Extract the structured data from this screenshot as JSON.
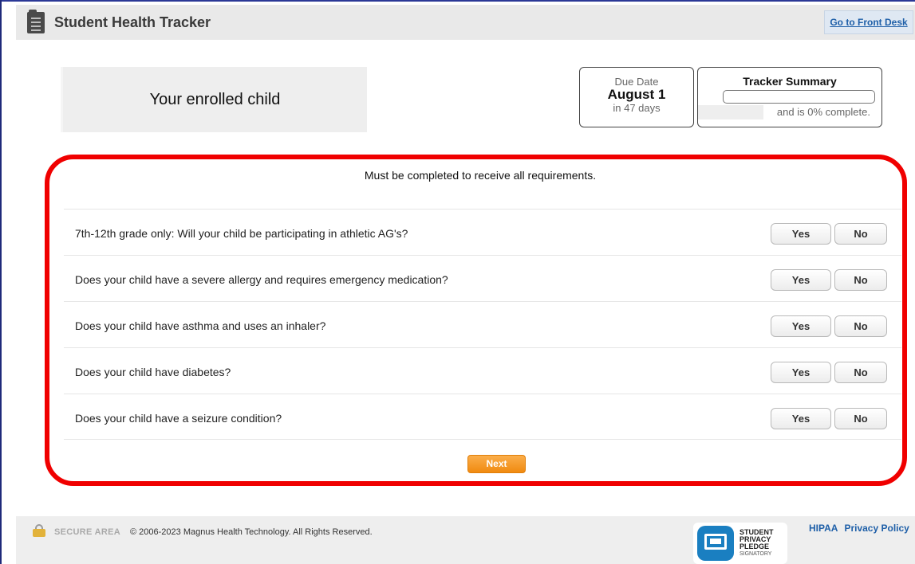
{
  "header": {
    "title": "Student Health Tracker",
    "front_desk_link": "Go to Front Desk"
  },
  "child_panel": {
    "label": "Your enrolled child"
  },
  "due": {
    "label": "Due Date",
    "date": "August 1",
    "days": "in 47 days"
  },
  "summary": {
    "title": "Tracker Summary",
    "status_text": "and is 0% complete.",
    "progress_percent": 0
  },
  "form": {
    "instruction": "Must be completed to receive all requirements.",
    "yes_label": "Yes",
    "no_label": "No",
    "questions": [
      "7th-12th grade only: Will your child be participating in athletic AG's?",
      "Does your child have a severe allergy and requires emergency medication?",
      "Does your child have asthma and uses an inhaler?",
      "Does your child have diabetes?",
      "Does your child have a seizure condition?"
    ],
    "next_label": "Next"
  },
  "footer": {
    "secure_label": "SECURE AREA",
    "copyright": "© 2006-2023 Magnus Health Technology. All Rights Reserved.",
    "pledge_lines": [
      "STUDENT",
      "PRIVACY",
      "PLEDGE",
      "SIGNATORY"
    ],
    "links": [
      "HIPAA",
      "Privacy Policy"
    ]
  },
  "colors": {
    "highlight_border": "#f00000",
    "next_button": "#f08a10",
    "link": "#1e5fa8",
    "pledge_badge": "#1a7fc1"
  },
  "icons": {
    "app": "tracker-document-icon",
    "secure": "lock-icon",
    "pledge": "privacy-pledge-badge-icon"
  }
}
